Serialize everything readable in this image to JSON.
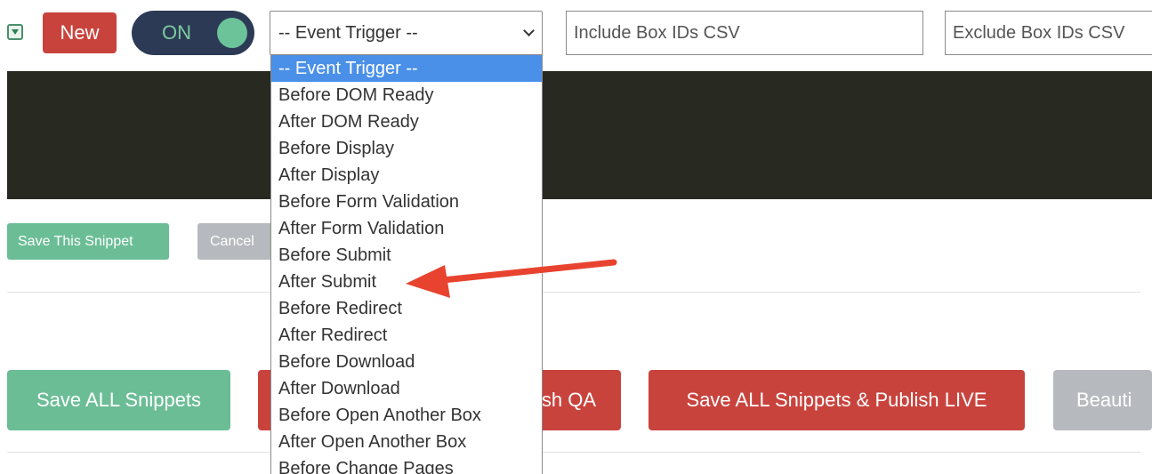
{
  "toolbar": {
    "new_label": "New",
    "toggle_label": "ON",
    "event_trigger_selected": "-- Event Trigger --",
    "include_placeholder": "Include Box IDs CSV",
    "exclude_placeholder": "Exclude Box IDs CSV"
  },
  "dropdown": {
    "options": [
      "-- Event Trigger --",
      "Before DOM Ready",
      "After DOM Ready",
      "Before Display",
      "After Display",
      "Before Form Validation",
      "After Form Validation",
      "Before Submit",
      "After Submit",
      "Before Redirect",
      "After Redirect",
      "Before Download",
      "After Download",
      "Before Open Another Box",
      "After Open Another Box",
      "Before Change Pages"
    ],
    "highlighted_index": 0
  },
  "snippet_actions": {
    "save_label": "Save This Snippet",
    "cancel_label": "Cancel"
  },
  "bulk_actions": {
    "save_all_label": "Save ALL Snippets",
    "publish_qa_visible": "sh QA",
    "publish_live_label": "Save ALL Snippets & Publish LIVE",
    "beautify_visible": "Beauti"
  },
  "colors": {
    "success": "#6bbd96",
    "danger": "#c9433d",
    "toggle_track": "#2c3a55",
    "editor_bg": "#282a22",
    "highlight": "#4a90e8",
    "arrow": "#e8432f"
  },
  "icons": {
    "collapse": "triangle-down-icon",
    "caret": "chevron-down-icon",
    "annotation": "red-arrow-icon"
  }
}
